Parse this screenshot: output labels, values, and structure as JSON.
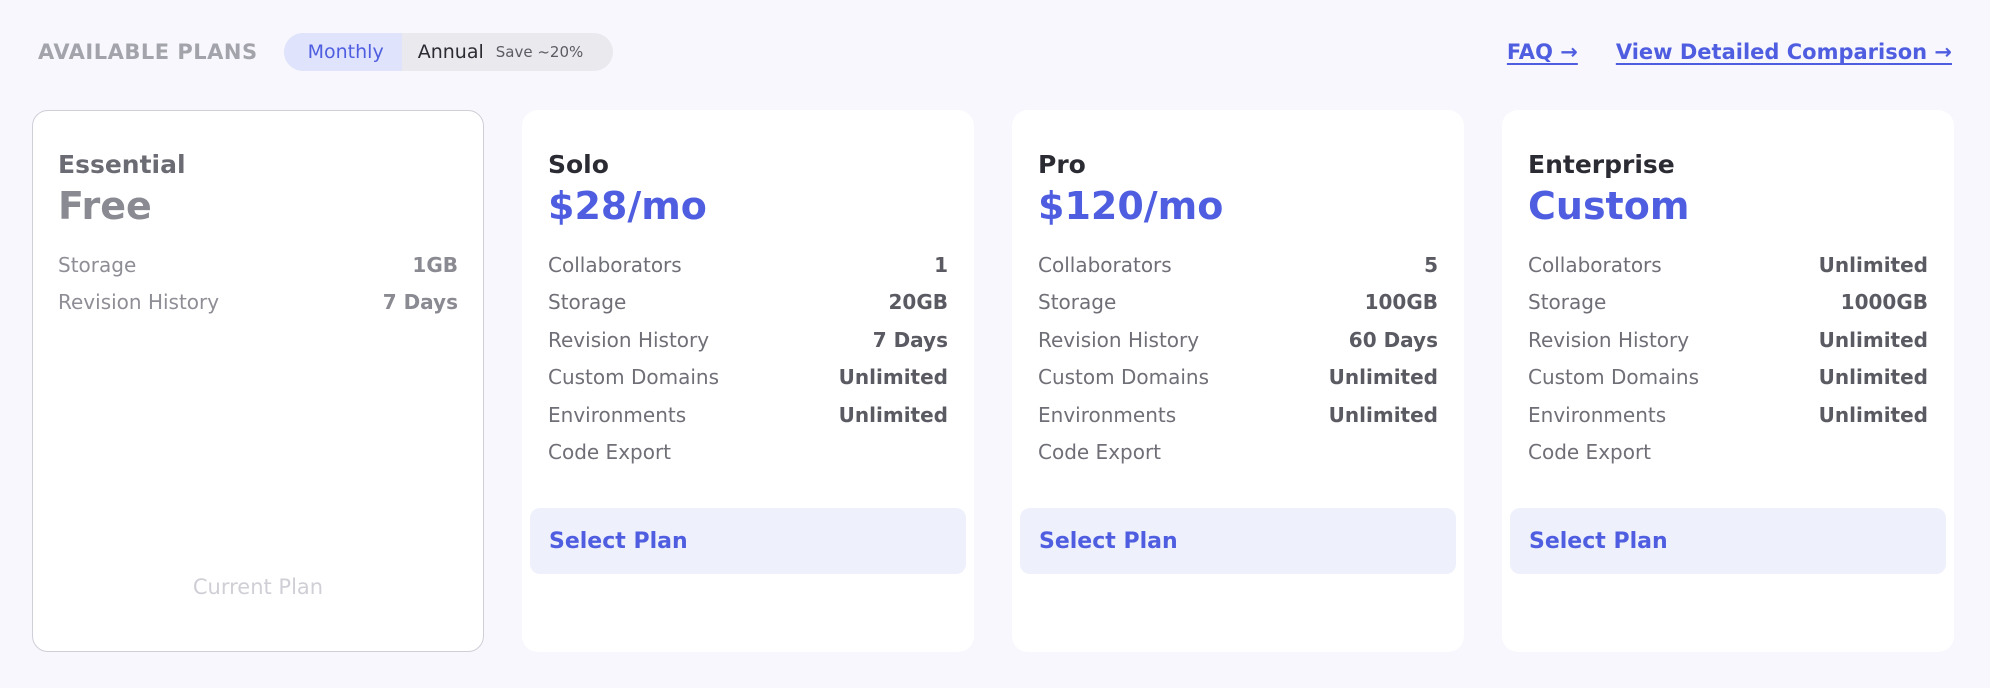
{
  "header": {
    "title": "AVAILABLE PLANS",
    "billing_toggle": {
      "monthly_label": "Monthly",
      "annual_label": "Annual",
      "annual_badge": "Save ~20%",
      "selected": "Monthly"
    },
    "faq_link": "FAQ →",
    "comparison_link": "View Detailed Comparison →"
  },
  "colors": {
    "accent": "#4f5ee0",
    "background": "#f7f7fd",
    "button_bg": "#eef0fb"
  },
  "plans": [
    {
      "name": "Essential",
      "price": "Free",
      "features": [
        {
          "label": "Storage",
          "value": "1GB"
        },
        {
          "label": "Revision History",
          "value": "7 Days"
        }
      ],
      "status_label": "Current Plan"
    },
    {
      "name": "Solo",
      "price": "$28/mo",
      "features": [
        {
          "label": "Collaborators",
          "value": "1"
        },
        {
          "label": "Storage",
          "value": "20GB"
        },
        {
          "label": "Revision History",
          "value": "7 Days"
        },
        {
          "label": "Custom Domains",
          "value": "Unlimited"
        },
        {
          "label": "Environments",
          "value": "Unlimited"
        },
        {
          "label": "Code Export",
          "value": ""
        }
      ],
      "button_label": "Select Plan"
    },
    {
      "name": "Pro",
      "price": "$120/mo",
      "features": [
        {
          "label": "Collaborators",
          "value": "5"
        },
        {
          "label": "Storage",
          "value": "100GB"
        },
        {
          "label": "Revision History",
          "value": "60 Days"
        },
        {
          "label": "Custom Domains",
          "value": "Unlimited"
        },
        {
          "label": "Environments",
          "value": "Unlimited"
        },
        {
          "label": "Code Export",
          "value": ""
        }
      ],
      "button_label": "Select Plan"
    },
    {
      "name": "Enterprise",
      "price": "Custom",
      "features": [
        {
          "label": "Collaborators",
          "value": "Unlimited"
        },
        {
          "label": "Storage",
          "value": "1000GB"
        },
        {
          "label": "Revision History",
          "value": "Unlimited"
        },
        {
          "label": "Custom Domains",
          "value": "Unlimited"
        },
        {
          "label": "Environments",
          "value": "Unlimited"
        },
        {
          "label": "Code Export",
          "value": ""
        }
      ],
      "button_label": "Select Plan"
    }
  ]
}
